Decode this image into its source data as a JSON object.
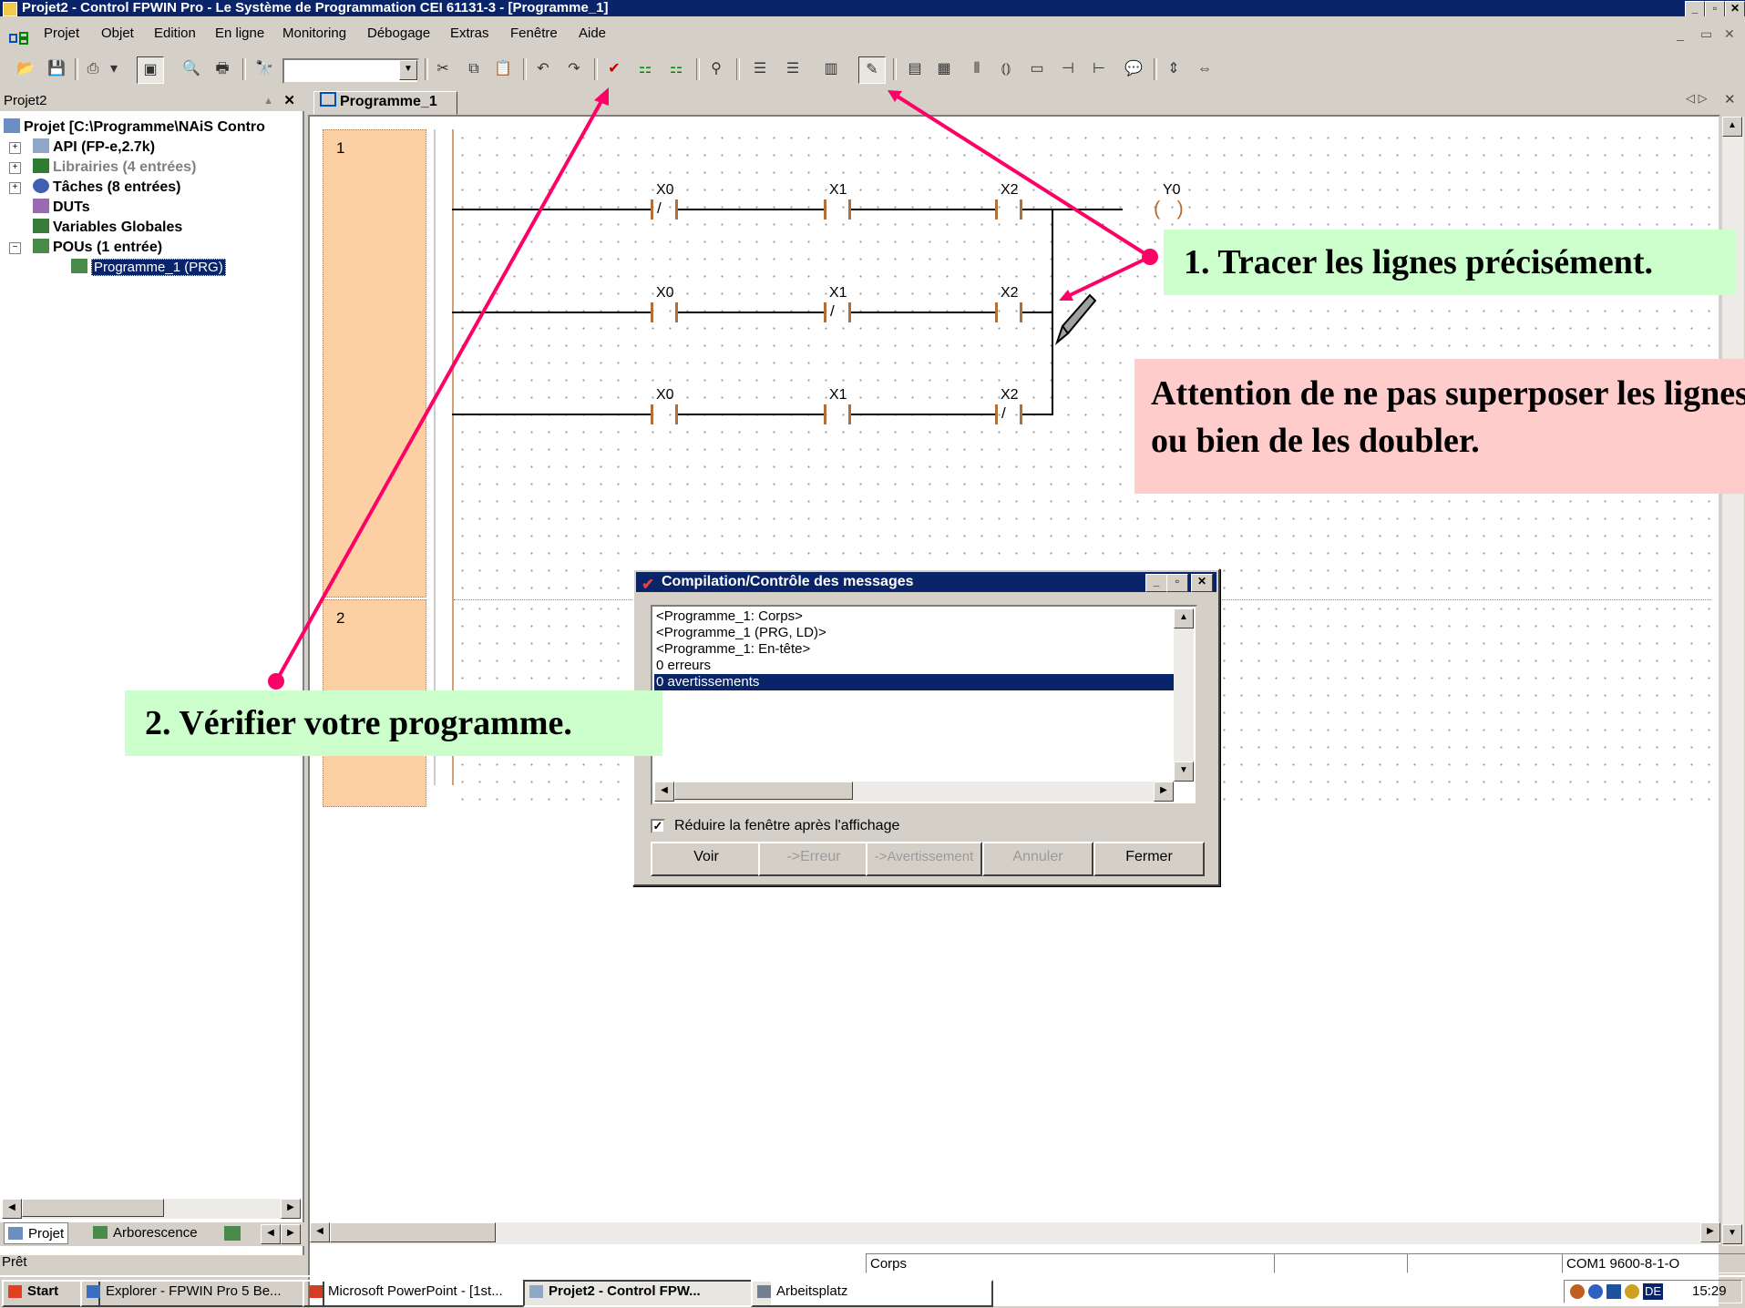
{
  "window": {
    "title": "Projet2 - Control FPWIN Pro - Le Système de Programmation CEI 61131-3 - [Programme_1]"
  },
  "menu": [
    "Projet",
    "Objet",
    "Edition",
    "En ligne",
    "Monitoring",
    "Débogage",
    "Extras",
    "Fenêtre",
    "Aide"
  ],
  "left_panel": {
    "title": "Projet2",
    "tree": [
      {
        "label": "Projet [C:\\Programme\\NAiS Contro",
        "color": "#000000"
      },
      {
        "label": "API (FP-e,2.7k)",
        "color": "#000000"
      },
      {
        "label": "Librairies (4 entrées)",
        "color": "#808080"
      },
      {
        "label": "Tâches (8 entrées)",
        "color": "#000000"
      },
      {
        "label": "DUTs",
        "color": "#000000"
      },
      {
        "label": "Variables Globales",
        "color": "#000000"
      },
      {
        "label": "POUs (1 entrée)",
        "color": "#000000"
      },
      {
        "label": "Programme_1 (PRG)",
        "color": "#ffffff"
      }
    ],
    "bottom_tabs": [
      "Projet",
      "Arborescence"
    ]
  },
  "editor": {
    "tab": "Programme_1",
    "networks": [
      {
        "number": "1",
        "rungs": [
          {
            "contacts": [
              {
                "name": "X0",
                "type": "/"
              },
              {
                "name": "X1",
                "type": ""
              },
              {
                "name": "X2",
                "type": ""
              }
            ],
            "coil": "Y0"
          },
          {
            "contacts": [
              {
                "name": "X0",
                "type": ""
              },
              {
                "name": "X1",
                "type": "/"
              },
              {
                "name": "X2",
                "type": ""
              }
            ]
          },
          {
            "contacts": [
              {
                "name": "X0",
                "type": ""
              },
              {
                "name": "X1",
                "type": ""
              },
              {
                "name": "X2",
                "type": "/"
              }
            ]
          }
        ]
      },
      {
        "number": "2"
      }
    ]
  },
  "dialog": {
    "title": "Compilation/Contrôle des messages",
    "messages": [
      "<Programme_1: Corps>",
      "<Programme_1 (PRG, LD)>",
      "<Programme_1: En-tête>",
      "0 erreurs",
      "0 avertissements"
    ],
    "selected_index": 4,
    "checkbox_label": "Réduire la fenêtre après l'affichage",
    "checkbox_checked": true,
    "buttons": [
      "Voir",
      "->Erreur",
      "->Avertissement",
      "Annuler",
      "Fermer"
    ]
  },
  "annotations": {
    "callout1": "1. Tracer les lignes précisément.",
    "callout1_bg": "#ccffcc",
    "warning": "Attention de ne pas superposer les lignes ou bien de les doubler.",
    "warning_bg": "#ffcccc",
    "callout2": "2. Vérifier votre programme.",
    "callout2_bg": "#ccffcc",
    "arrow_color": "#ff0066"
  },
  "statusbar": {
    "status": "Prêt",
    "section": "Corps",
    "connection": "COM1 9600-8-1-O"
  },
  "taskbar": {
    "start": "Start",
    "tasks": [
      "Explorer - FPWIN Pro 5 Be...",
      "Microsoft PowerPoint - [1st...",
      "Projet2 - Control FPW...",
      "Arbeitsplatz"
    ],
    "active_index": 2,
    "lang": "DE",
    "clock": "15:29"
  },
  "colors": {
    "titlebar": "#0a246a",
    "network_margin": "#fcd0a4",
    "contact": "#b0703a"
  }
}
